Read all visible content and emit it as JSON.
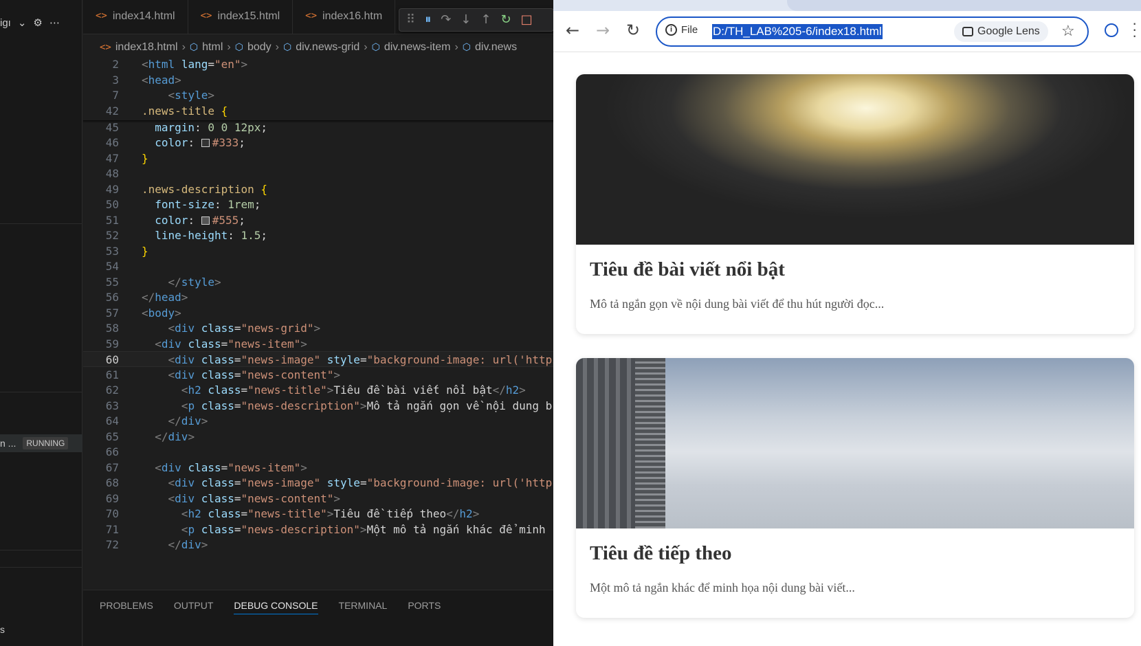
{
  "sidebar": {
    "partial_label": "igı",
    "running_partial": "n ...",
    "running_badge": "RUNNING",
    "bottom_char": "s"
  },
  "editor": {
    "tabs": [
      {
        "label": "index14.html"
      },
      {
        "label": "index15.html"
      },
      {
        "label": "index16.htm"
      }
    ],
    "breadcrumb": [
      "index18.html",
      "html",
      "body",
      "div.news-grid",
      "div.news-item",
      "div.news"
    ],
    "sticky": [
      {
        "n": "2",
        "html": "<span class=\"tg\">&lt;</span><span class=\"tn\">html</span> <span class=\"at\">lang</span><span class=\"pl\">=</span><span class=\"sv\">\"en\"</span><span class=\"tg\">&gt;</span>",
        "indent": 0
      },
      {
        "n": "3",
        "html": "<span class=\"tg\">&lt;</span><span class=\"tn\">head</span><span class=\"tg\">&gt;</span>",
        "indent": 0
      },
      {
        "n": "7",
        "html": "    <span class=\"tg\">&lt;</span><span class=\"tn\">style</span><span class=\"tg\">&gt;</span>",
        "indent": 0
      },
      {
        "n": "42",
        "html": "<span class=\"sel\">.news-title</span> <span class=\"br\">{</span>",
        "indent": 0
      }
    ],
    "lines": [
      {
        "n": "45",
        "html": "  <span class=\"at\">margin</span><span class=\"pl\">: </span><span class=\"num\">0 0 12px</span><span class=\"pl\">;</span>"
      },
      {
        "n": "46",
        "html": "  <span class=\"at\">color</span><span class=\"pl\">: </span><span class=\"sw\" style=\"background:#333\"></span><span class=\"sv\">#333</span><span class=\"pl\">;</span>"
      },
      {
        "n": "47",
        "html": "<span class=\"br\">}</span>"
      },
      {
        "n": "48",
        "html": ""
      },
      {
        "n": "49",
        "html": "<span class=\"sel\">.news-description</span> <span class=\"br\">{</span>"
      },
      {
        "n": "50",
        "html": "  <span class=\"at\">font-size</span><span class=\"pl\">: </span><span class=\"num\">1rem</span><span class=\"pl\">;</span>"
      },
      {
        "n": "51",
        "html": "  <span class=\"at\">color</span><span class=\"pl\">: </span><span class=\"sw\" style=\"background:#555\"></span><span class=\"sv\">#555</span><span class=\"pl\">;</span>"
      },
      {
        "n": "52",
        "html": "  <span class=\"at\">line-height</span><span class=\"pl\">: </span><span class=\"num\">1.5</span><span class=\"pl\">;</span>"
      },
      {
        "n": "53",
        "html": "<span class=\"br\">}</span>"
      },
      {
        "n": "54",
        "html": ""
      },
      {
        "n": "55",
        "html": "    <span class=\"tg\">&lt;/</span><span class=\"tn\">style</span><span class=\"tg\">&gt;</span>"
      },
      {
        "n": "56",
        "html": "<span class=\"tg\">&lt;/</span><span class=\"tn\">head</span><span class=\"tg\">&gt;</span>"
      },
      {
        "n": "57",
        "html": "<span class=\"tg\">&lt;</span><span class=\"tn\">body</span><span class=\"tg\">&gt;</span>"
      },
      {
        "n": "58",
        "html": "    <span class=\"tg\">&lt;</span><span class=\"tn\">div</span> <span class=\"at\">class</span><span class=\"pl\">=</span><span class=\"sv\">\"news-grid\"</span><span class=\"tg\">&gt;</span>"
      },
      {
        "n": "59",
        "html": "  <span class=\"tg\">&lt;</span><span class=\"tn\">div</span> <span class=\"at\">class</span><span class=\"pl\">=</span><span class=\"sv\">\"news-item\"</span><span class=\"tg\">&gt;</span>"
      },
      {
        "n": "60",
        "html": "    <span class=\"tg\">&lt;</span><span class=\"tn\">div</span> <span class=\"at\">class</span><span class=\"pl\">=</span><span class=\"sv\">\"news-image\"</span> <span class=\"at\">style</span><span class=\"pl\">=</span><span class=\"sv\">\"background-image: url('https</span>",
        "current": true
      },
      {
        "n": "61",
        "html": "    <span class=\"tg\">&lt;</span><span class=\"tn\">div</span> <span class=\"at\">class</span><span class=\"pl\">=</span><span class=\"sv\">\"news-content\"</span><span class=\"tg\">&gt;</span>"
      },
      {
        "n": "62",
        "html": "      <span class=\"tg\">&lt;</span><span class=\"tn\">h2</span> <span class=\"at\">class</span><span class=\"pl\">=</span><span class=\"sv\">\"news-title\"</span><span class=\"tg\">&gt;</span><span class=\"pl\">Tiêu đề bài viết nổi bật</span><span class=\"tg\">&lt;/</span><span class=\"tn\">h2</span><span class=\"tg\">&gt;</span>"
      },
      {
        "n": "63",
        "html": "      <span class=\"tg\">&lt;</span><span class=\"tn\">p</span> <span class=\"at\">class</span><span class=\"pl\">=</span><span class=\"sv\">\"news-description\"</span><span class=\"tg\">&gt;</span><span class=\"pl\">Mô tả ngắn gọn về nội dung b</span>"
      },
      {
        "n": "64",
        "html": "    <span class=\"tg\">&lt;/</span><span class=\"tn\">div</span><span class=\"tg\">&gt;</span>"
      },
      {
        "n": "65",
        "html": "  <span class=\"tg\">&lt;/</span><span class=\"tn\">div</span><span class=\"tg\">&gt;</span>"
      },
      {
        "n": "66",
        "html": ""
      },
      {
        "n": "67",
        "html": "  <span class=\"tg\">&lt;</span><span class=\"tn\">div</span> <span class=\"at\">class</span><span class=\"pl\">=</span><span class=\"sv\">\"news-item\"</span><span class=\"tg\">&gt;</span>"
      },
      {
        "n": "68",
        "html": "    <span class=\"tg\">&lt;</span><span class=\"tn\">div</span> <span class=\"at\">class</span><span class=\"pl\">=</span><span class=\"sv\">\"news-image\"</span> <span class=\"at\">style</span><span class=\"pl\">=</span><span class=\"sv\">\"background-image: url('http</span>"
      },
      {
        "n": "69",
        "html": "    <span class=\"tg\">&lt;</span><span class=\"tn\">div</span> <span class=\"at\">class</span><span class=\"pl\">=</span><span class=\"sv\">\"news-content\"</span><span class=\"tg\">&gt;</span>"
      },
      {
        "n": "70",
        "html": "      <span class=\"tg\">&lt;</span><span class=\"tn\">h2</span> <span class=\"at\">class</span><span class=\"pl\">=</span><span class=\"sv\">\"news-title\"</span><span class=\"tg\">&gt;</span><span class=\"pl\">Tiêu đề tiếp theo</span><span class=\"tg\">&lt;/</span><span class=\"tn\">h2</span><span class=\"tg\">&gt;</span>"
      },
      {
        "n": "71",
        "html": "      <span class=\"tg\">&lt;</span><span class=\"tn\">p</span> <span class=\"at\">class</span><span class=\"pl\">=</span><span class=\"sv\">\"news-description\"</span><span class=\"tg\">&gt;</span><span class=\"pl\">Một mô tả ngắn khác để minh</span>"
      },
      {
        "n": "72",
        "html": "    <span class=\"tg\">&lt;/</span><span class=\"tn\">div</span><span class=\"tg\">&gt;</span>"
      }
    ]
  },
  "panel": {
    "tabs": [
      "PROBLEMS",
      "OUTPUT",
      "DEBUG CONSOLE",
      "TERMINAL",
      "PORTS"
    ],
    "active": "DEBUG CONSOLE"
  },
  "browser": {
    "omnibox": {
      "scheme_label": "File",
      "url": "D:/TH_LAB%205-6/index18.html"
    },
    "lens_label": "Google Lens",
    "articles": [
      {
        "title": "Tiêu đề bài viết nổi bật",
        "description": "Mô tả ngắn gọn về nội dung bài viết để thu hút người đọc...",
        "image": "fireworks"
      },
      {
        "title": "Tiêu đề tiếp theo",
        "description": "Một mô tả ngắn khác để minh họa nội dung bài viết...",
        "image": "sky"
      }
    ]
  },
  "colors": {
    "accent": "#1a56c7",
    "editor_bg": "#1e1e1e",
    "sidebar_bg": "#181818"
  }
}
